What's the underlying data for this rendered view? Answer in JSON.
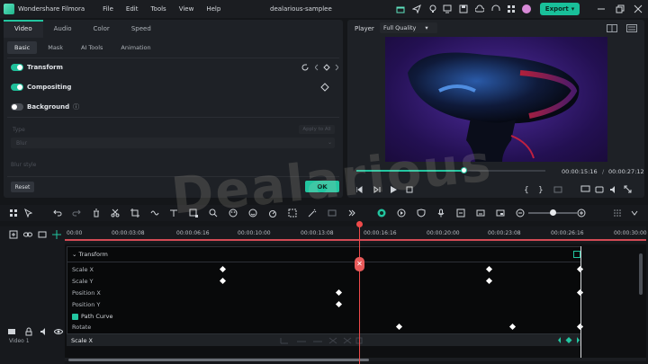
{
  "app": {
    "name": "Wondershare Filmora",
    "project": "dealarious-samplee",
    "menu": [
      "File",
      "Edit",
      "Tools",
      "View",
      "Help"
    ],
    "export_label": "Export"
  },
  "props": {
    "tabs": [
      "Video",
      "Audio",
      "Color",
      "Speed"
    ],
    "subtabs": [
      "Basic",
      "Mask",
      "AI Tools",
      "Animation"
    ],
    "transform": "Transform",
    "compositing": "Compositing",
    "background": "Background",
    "type_label": "Type",
    "apply_all": "Apply to All",
    "blur_value": "Blur",
    "blur_style": "Blur style",
    "reset": "Reset",
    "ok": "OK"
  },
  "player": {
    "label": "Player",
    "quality": "Full Quality",
    "current": "00:00:15:16",
    "sep": "/",
    "total": "00:00:27:12",
    "progress": 0.57
  },
  "ruler": [
    "00:00",
    "00:00:03:08",
    "00:00:06:16",
    "00:00:10:00",
    "00:00:13:08",
    "00:00:16:16",
    "00:00:20:00",
    "00:00:23:08",
    "00:00:26:16",
    "00:00:30:00"
  ],
  "keyframes": {
    "header": "Transform",
    "rows": [
      "Scale X",
      "Scale Y",
      "Position X",
      "Position Y",
      "Path Curve",
      "Rotate"
    ],
    "selected": "Scale X"
  },
  "track": {
    "label": "Video 1"
  },
  "watermark": "Dealarious",
  "colors": {
    "accent": "#22c5a0",
    "playhead": "#ef4a4a"
  }
}
